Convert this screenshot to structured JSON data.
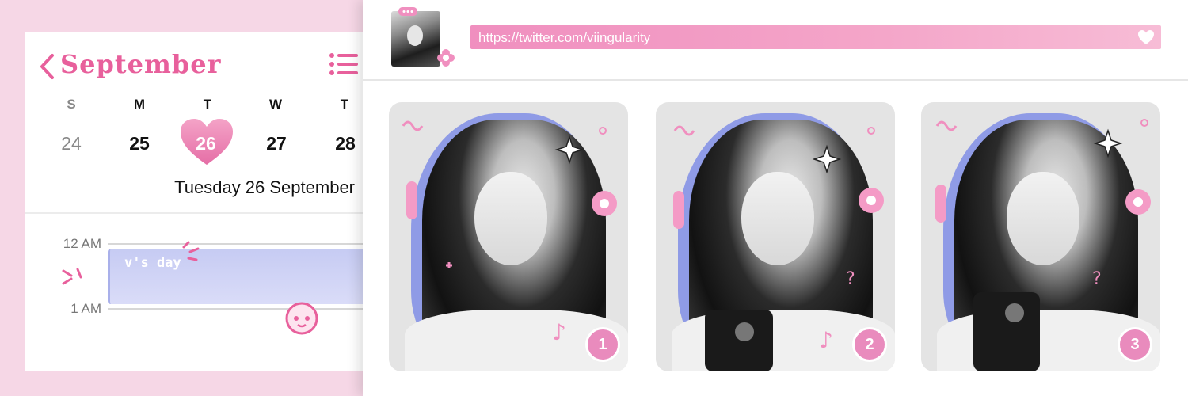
{
  "calendar": {
    "month": "September",
    "weekdays": [
      "S",
      "M",
      "T",
      "W",
      "T"
    ],
    "days": [
      "24",
      "25",
      "26",
      "27",
      "28"
    ],
    "selected_day": "26",
    "date_label": "Tuesday 26 September",
    "times": [
      "12 AM",
      "1 AM"
    ],
    "event": {
      "title": "v's day"
    }
  },
  "browser": {
    "url": "https://twitter.com/viingularity",
    "cards": [
      {
        "badge": "1"
      },
      {
        "badge": "2"
      },
      {
        "badge": "3"
      }
    ]
  },
  "colors": {
    "accent_pink": "#e8609c",
    "event_lavender": "#c6cbf3",
    "background": "#f6d7e6"
  },
  "icons": {
    "back": "chevron-left-icon",
    "list": "list-icon",
    "favorite": "heart-icon"
  }
}
